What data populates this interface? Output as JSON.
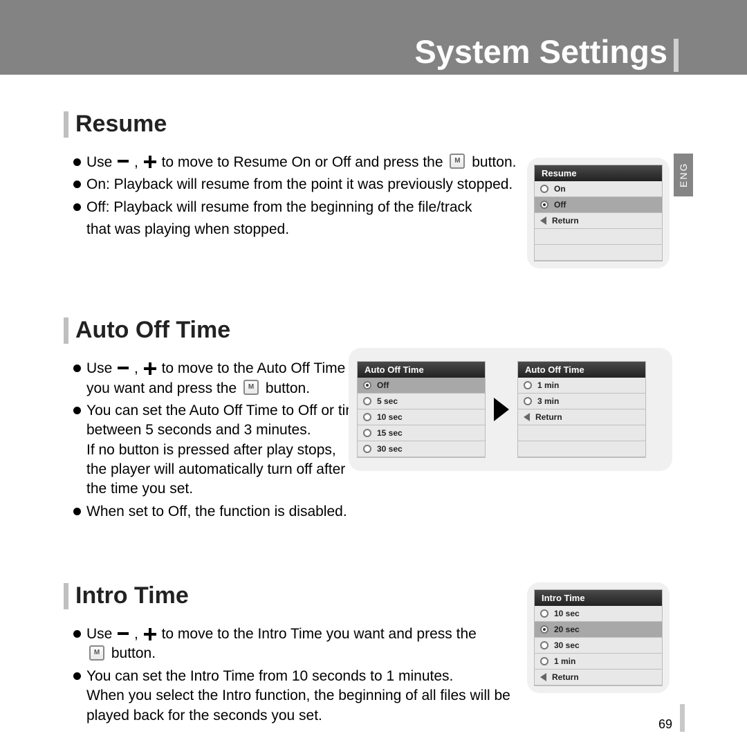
{
  "page": {
    "title": "System Settings",
    "language_tab": "ENG",
    "number": "69"
  },
  "sections": [
    {
      "title": "Resume",
      "text": {
        "b1a": "Use",
        "b1b": " to move to Resume On or Off and press the",
        "b1c": "button.",
        "b2": "On: Playback will resume from the point it was previously stopped.",
        "b3": "Off: Playback will resume from the beginning of the file/track",
        "b3_cont": "that was playing when stopped."
      },
      "menu": {
        "header": "Resume",
        "rows": [
          "On",
          "Off",
          "Return"
        ]
      }
    },
    {
      "title": "Auto Off Time",
      "text": {
        "b1a": "Use",
        "b1b": " to move to the Auto Off Time",
        "b1_cont": "you want and press the",
        "b1c": "button.",
        "b2": "You can set the Auto Off Time to Off or time",
        "b2_cont1": "between 5 seconds and 3 minutes.",
        "b2_cont2": "If no button is pressed after play stops,",
        "b2_cont3": "the player will automatically turn off after",
        "b2_cont4": "the time you set.",
        "b3": "When set to Off, the function is disabled."
      },
      "menu1": {
        "header": "Auto Off Time",
        "rows": [
          "Off",
          "5 sec",
          "10 sec",
          "15 sec",
          "30 sec"
        ]
      },
      "menu2": {
        "header": "Auto Off Time",
        "rows": [
          "1 min",
          "3 min",
          "Return"
        ]
      }
    },
    {
      "title": "Intro Time",
      "text": {
        "b1a": "Use",
        "b1b": " to move to the Intro Time you want and press the",
        "b1_cont": "",
        "b1c": "button.",
        "b2": "You can set the Intro Time from 10 seconds to 1 minutes.",
        "b2_cont1": "When you select the Intro function, the beginning of all files will be",
        "b2_cont2": "played back for the seconds you set."
      },
      "menu": {
        "header": "Intro Time",
        "rows": [
          "10 sec",
          "20 sec",
          "30 sec",
          "1 min",
          "Return"
        ]
      }
    }
  ]
}
